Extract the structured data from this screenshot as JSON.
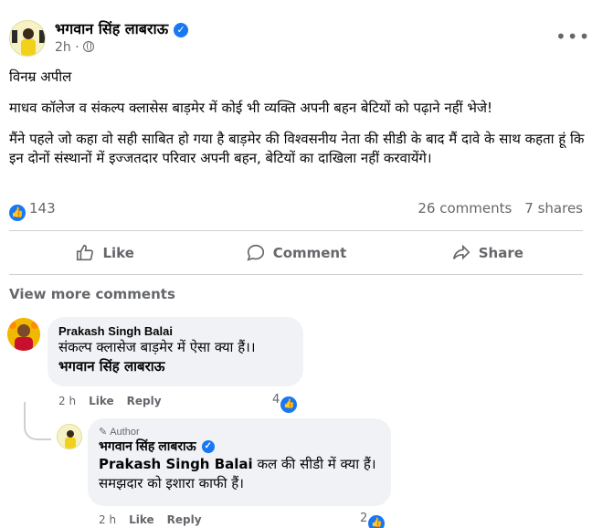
{
  "post": {
    "author": "भगवान सिंह लाबराऊ",
    "time": "2h ·",
    "more_icon": "•••",
    "paragraphs": [
      "विनम्र अपील",
      "माधव कॉलेज व संकल्प क्लासेस बाड़मेर में कोई भी व्यक्ति अपनी बहन बेटियों को पढ़ाने नहीं भेजे!",
      "मैंने पहले जो कहा वो सही साबित हो गया है बाड़मेर की विश्वसनीय नेता की सीडी के बाद मैं दावे के साथ कहता हूं कि इन दोनों संस्थानों में इज्जतदार परिवार अपनी बहन, बेटियों का दाखिला नहीं करवायेंगे।"
    ],
    "reaction_count": "143",
    "comments_count": "26 comments",
    "shares_count": "7 shares"
  },
  "actions": {
    "like": "Like",
    "comment": "Comment",
    "share": "Share"
  },
  "view_more_comments": "View more comments",
  "comments": [
    {
      "name": "Prakash Singh Balai",
      "line1": "संकल्प क्लासेज बाड़मेर में ऐसा क्या हैं।।",
      "line2": "भगवान सिंह लाबराऊ",
      "time": "2 h",
      "like": "Like",
      "reply": "Reply",
      "reactions": "4"
    },
    {
      "tag": "Author",
      "name": "भगवान सिंह लाबराऊ",
      "mention": "Prakash Singh Balai",
      "line1_rest": " कल की सीडी में क्या हैं।",
      "line2": "समझदार को इशारा काफी हैं।",
      "time": "2 h",
      "like": "Like",
      "reply": "Reply",
      "reactions": "2"
    }
  ],
  "colors": {
    "accent": "#1877f2",
    "secondary_text": "#65676b",
    "bubble": "#f0f2f5"
  }
}
